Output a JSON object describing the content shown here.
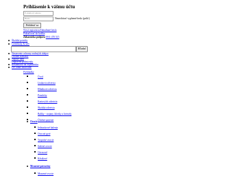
{
  "login": {
    "title": "Prihlásenie k vášmu účtu",
    "email_placeholder": "E-mailová adresa",
    "password_placeholder": "Heslo",
    "remember_label": "Nenechávať vyplnené heslo (prihl.)",
    "login_button": "Prihlásiť sa",
    "register_link": "Nová registrácia/Zabudnuté heslo",
    "orders_link": "Pokračovať do košíka",
    "support_label": "Zákaznícka podpora",
    "support_phone": "0911 470 515"
  },
  "top_menu": {
    "items": [
      "Školské potreby",
      "Certifikáty & slev",
      "Osobné kontakty",
      "Drôtové spony",
      "Rozbaľovacie trakty"
    ]
  },
  "search": {
    "button_label": "Hľadať",
    "input_value": ""
  },
  "overlay_links": [
    "Nastavenie ochrany osobných údajov",
    "Napíšte nám",
    "Dopravné podmienky",
    "Reklamácia na objednávku",
    "Pre ľahké zdravotne"
  ],
  "sections": [
    {
      "label": "Prehliadky",
      "items": [
        "Úvod",
        "Lístková odvetvia",
        "Hliníková odvetvia",
        "Pomôcky",
        "Kartových odvetvia",
        "Školská odvetvia",
        "Balíky - stojany, klietky a hviezdy",
        "Úložná spojenie"
      ]
    },
    {
      "label": "Ovocie",
      "items": [
        "Jednorázové balenia",
        "Ovocné pyré",
        "Tropické ovocie",
        "Sušené ovocie",
        "Citrusové",
        "Kôstkové"
      ]
    },
    {
      "label": "Mrazené potraviny",
      "items": [
        "Mrazené ovocie"
      ]
    }
  ]
}
